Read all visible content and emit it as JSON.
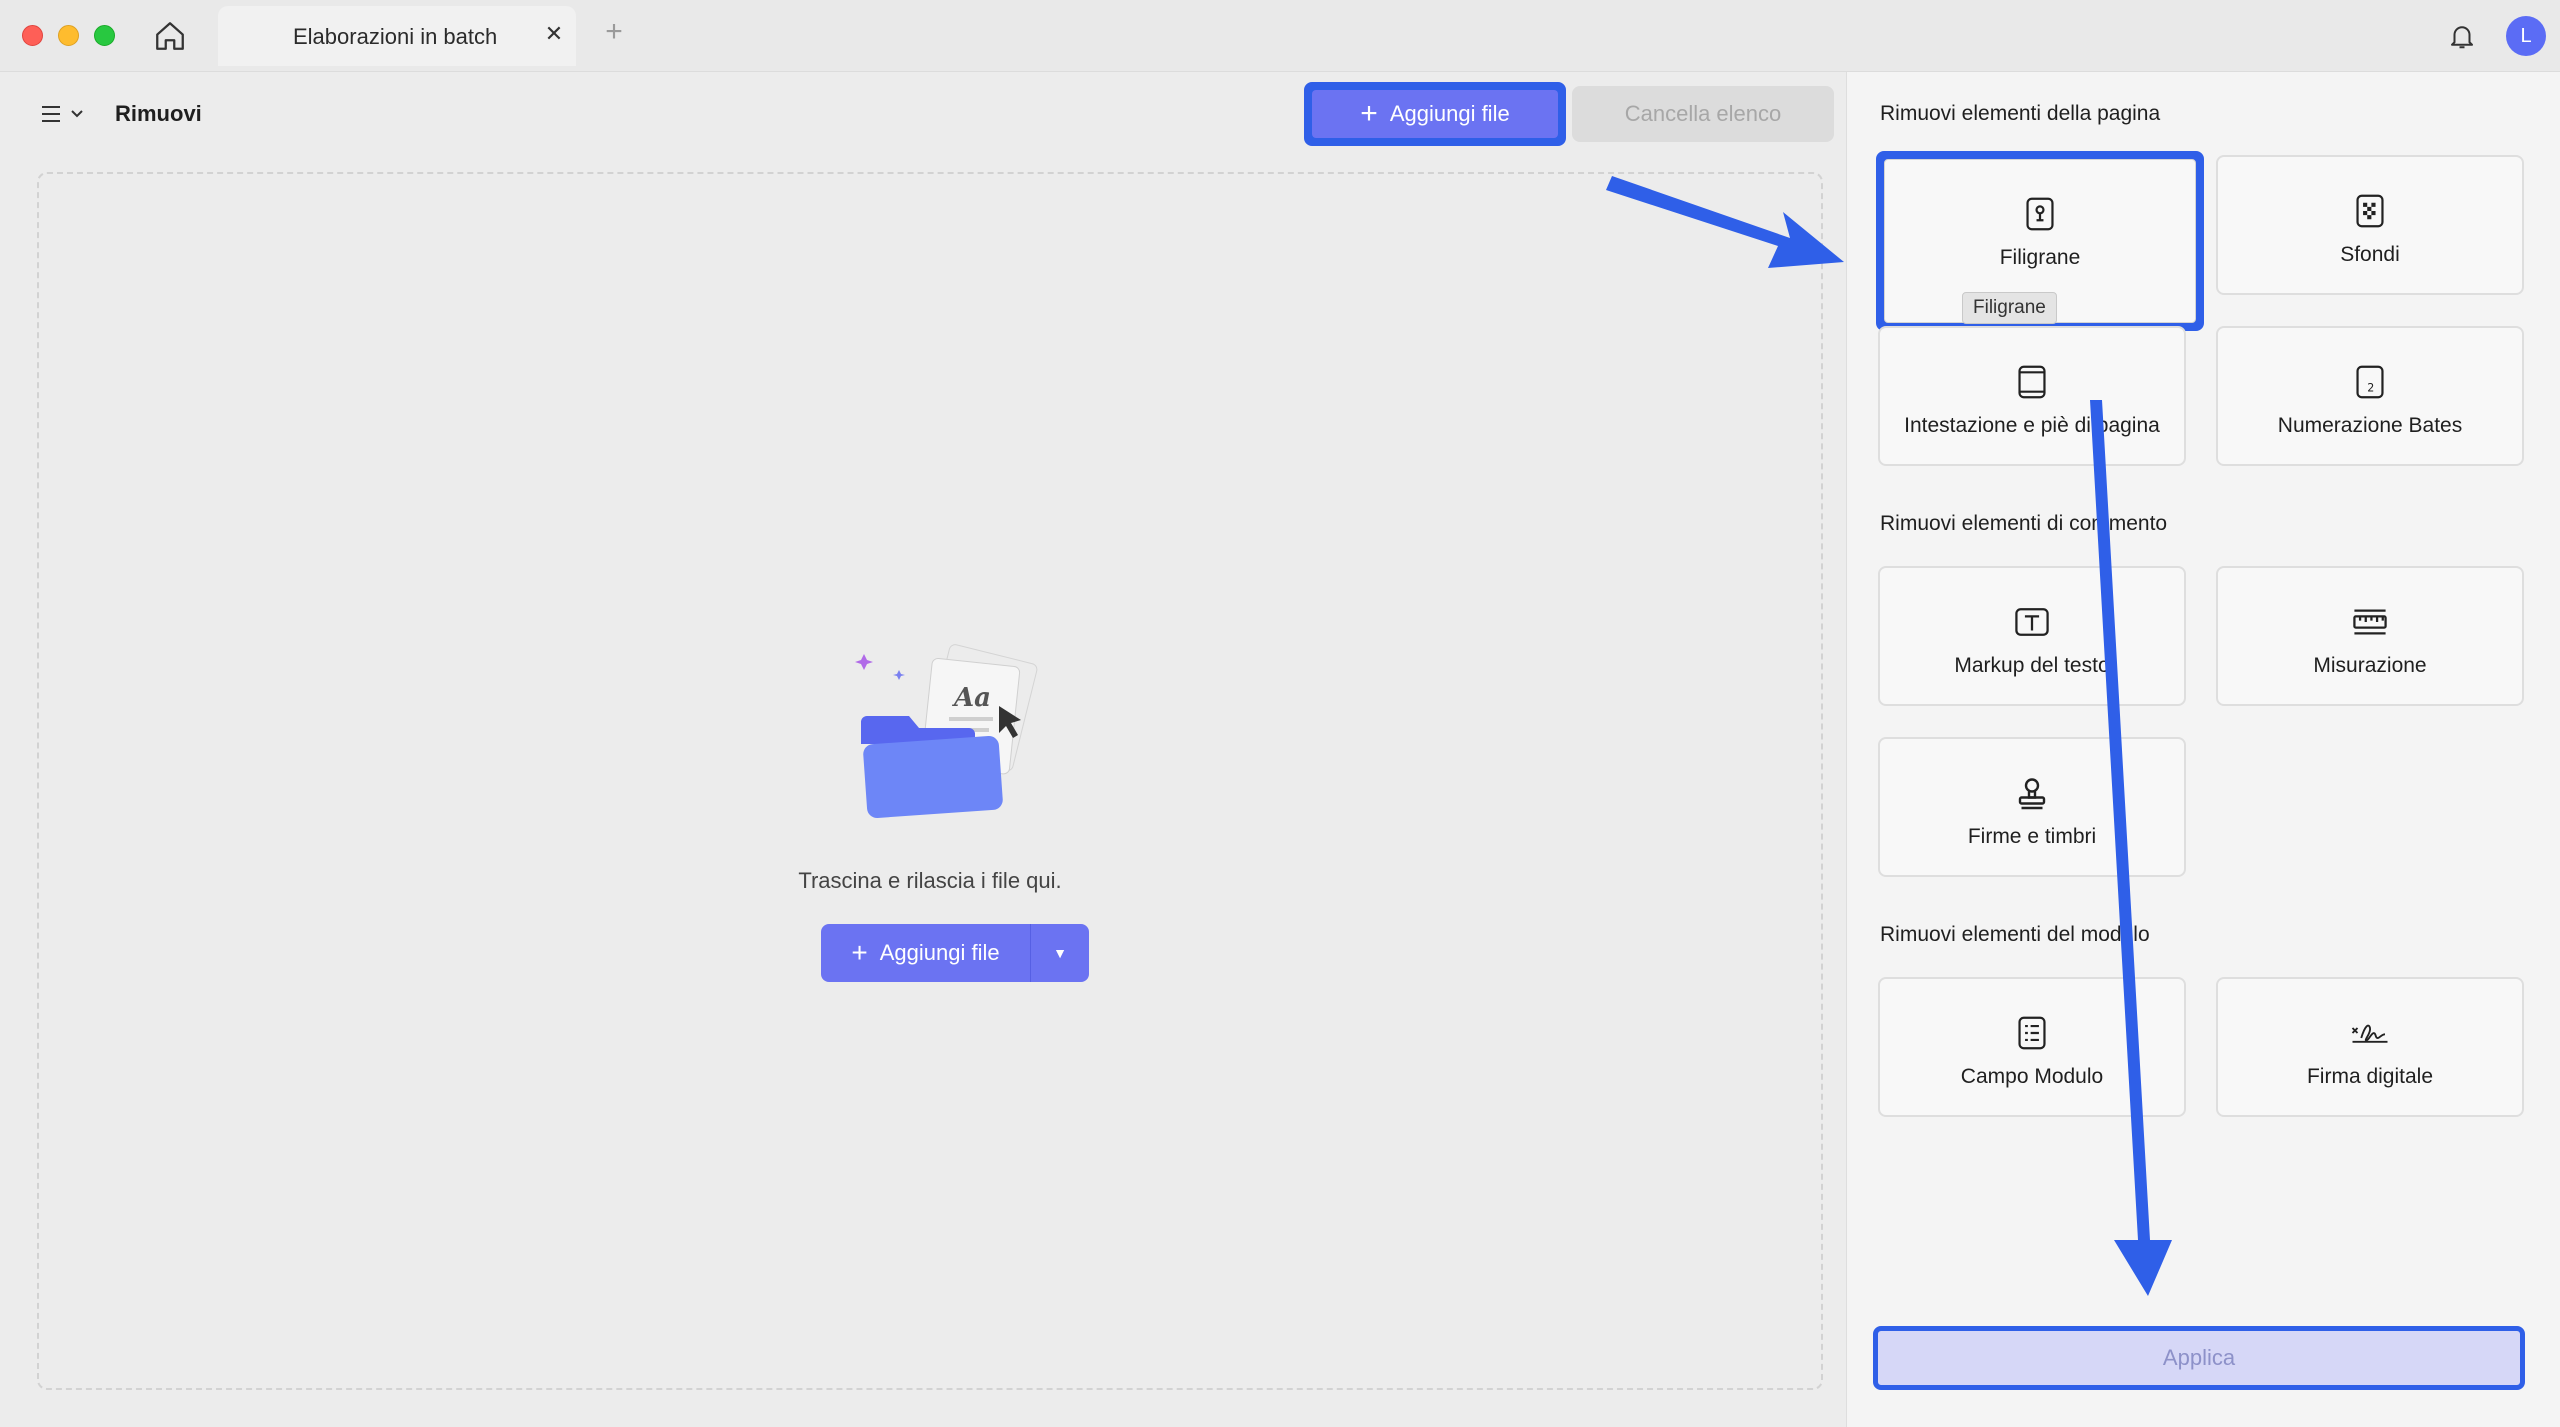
{
  "window": {
    "tab_title": "Elaborazioni in batch",
    "tab_close": "✕",
    "tab_add": "+",
    "avatar_initial": "L",
    "icons": [
      "home-icon",
      "bell-icon"
    ]
  },
  "toolbar": {
    "title": "Rimuovi",
    "add_file_label": "Aggiungi file",
    "clear_list_label": "Cancella elenco"
  },
  "dropzone": {
    "hint": "Trascina e rilascia i file qui.",
    "add_file_label": "Aggiungi file",
    "dropdown_glyph": "▼"
  },
  "panel": {
    "sections": [
      {
        "title": "Rimuovi elementi della pagina",
        "options": [
          {
            "label": "Filigrane",
            "icon": "watermark-icon",
            "selected": true
          },
          {
            "label": "Sfondi",
            "icon": "background-icon"
          },
          {
            "label": "Intestazione e piè di pagina",
            "icon": "header-footer-icon"
          },
          {
            "label": "Numerazione Bates",
            "icon": "bates-numbering-icon"
          }
        ]
      },
      {
        "title": "Rimuovi elementi di commento",
        "options": [
          {
            "label": "Markup del testo",
            "icon": "text-markup-icon"
          },
          {
            "label": "Misurazione",
            "icon": "measure-icon"
          },
          {
            "label": "Firme e timbri",
            "icon": "stamp-icon"
          }
        ]
      },
      {
        "title": "Rimuovi elementi del modulo",
        "options": [
          {
            "label": "Campo Modulo",
            "icon": "form-field-icon"
          },
          {
            "label": "Firma digitale",
            "icon": "digital-signature-icon"
          }
        ]
      }
    ],
    "tooltip": "Filigrane",
    "apply_label": "Applica"
  },
  "colors": {
    "accent": "#6b73f2",
    "highlight": "#2f5fe8"
  }
}
